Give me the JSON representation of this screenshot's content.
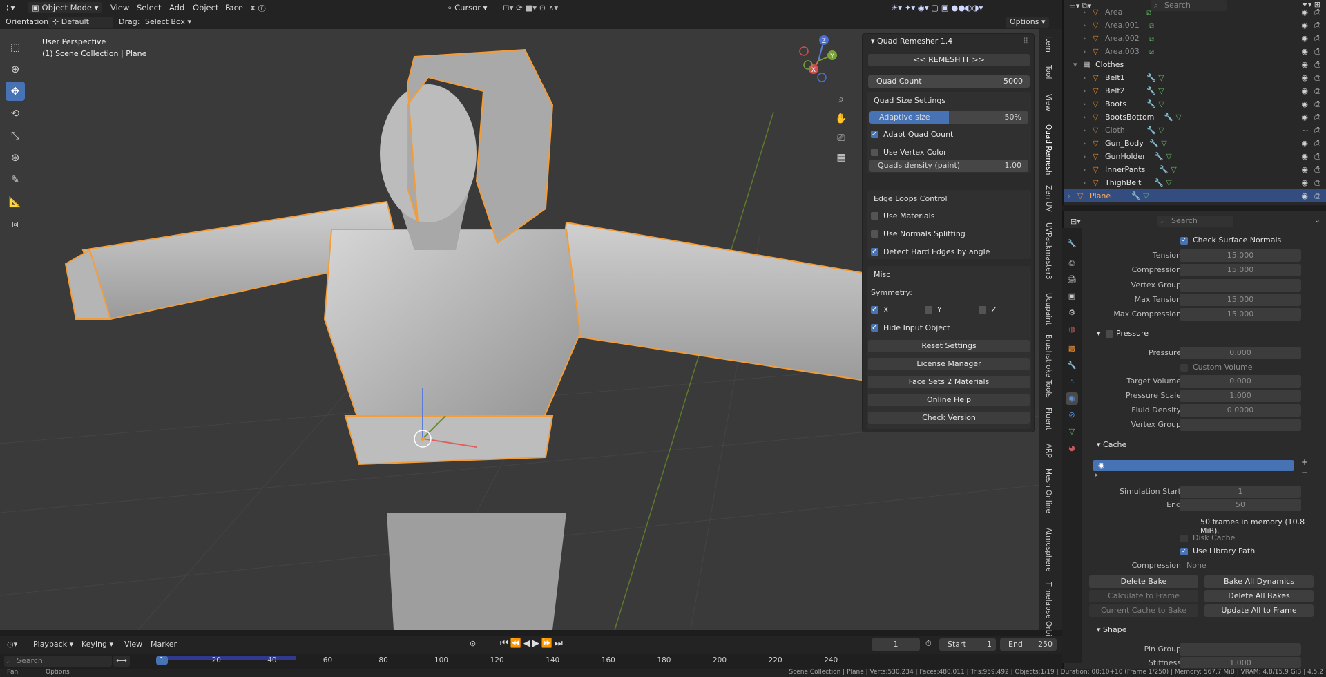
{
  "header": {
    "mode": "Object Mode",
    "menus": [
      "View",
      "Select",
      "Add",
      "Object",
      "Face"
    ],
    "pivot": "Cursor",
    "options": "Options"
  },
  "tool_header": {
    "orientation_label": "Orientation:",
    "orientation_value": "Default",
    "drag_label": "Drag:",
    "drag_value": "Select Box"
  },
  "viewport": {
    "perspective": "User Perspective",
    "collection": "(1) Scene Collection | Plane",
    "gizmo_axes": [
      "Z",
      "Y",
      "X"
    ]
  },
  "npanel": {
    "title": "Quad Remesher 1.4",
    "remesh_button": "<< REMESH IT >>",
    "quad_count_label": "Quad Count",
    "quad_count_value": "5000",
    "size_section": "Quad Size Settings",
    "adaptive_label": "Adaptive size",
    "adaptive_value": "50%",
    "adaptive_fraction": 0.5,
    "adapt_quad_count": "Adapt Quad Count",
    "use_vertex_color": "Use Vertex Color",
    "density_label": "Quads density (paint)",
    "density_value": "1.00",
    "edge_section": "Edge Loops Control",
    "use_materials": "Use Materials",
    "use_normals": "Use Normals Splitting",
    "detect_hard": "Detect Hard Edges by angle",
    "misc_section": "Misc",
    "symmetry_label": "Symmetry:",
    "sym_x": "X",
    "sym_y": "Y",
    "sym_z": "Z",
    "hide_input": "Hide Input Object",
    "buttons": [
      "Reset Settings",
      "License Manager",
      "Face Sets 2 Materials",
      "Online Help",
      "Check Version"
    ]
  },
  "vtabs": [
    "Item",
    "Tool",
    "View",
    "Quad Remesh",
    "Zen UV",
    "UVPackmaster3",
    "Ucupaint",
    "Brushstroke Tools",
    "Fluent",
    "ARP",
    "Mesh Online",
    "Atmosphere",
    "Timelapse Orbit"
  ],
  "timeline": {
    "menus": [
      "Playback",
      "Keying",
      "View",
      "Marker"
    ],
    "current_frame": "1",
    "start_label": "Start",
    "start_value": "1",
    "end_label": "End",
    "end_value": "250",
    "search_placeholder": "Search",
    "ticks": [
      "1",
      "20",
      "40",
      "60",
      "80",
      "100",
      "120",
      "140",
      "160",
      "180",
      "200",
      "220",
      "240"
    ]
  },
  "statusbar": {
    "left": [
      "Pan",
      "Options"
    ],
    "right": "Scene Collection | Plane | Verts:530,234 | Faces:480,011 | Tris:959,492 | Objects:1/19 | Duration: 00:10+10 (Frame 1/250) | Memory: 567.7 MiB | VRAM: 4.8/15.9 GiB | 4.5.2"
  },
  "outliner": {
    "search_placeholder": "Search",
    "rows": [
      {
        "name": "Area",
        "dim": true
      },
      {
        "name": "Area.001",
        "dim": true
      },
      {
        "name": "Area.002",
        "dim": true
      },
      {
        "name": "Area.003",
        "dim": true
      },
      {
        "name": "Clothes",
        "dim": false
      },
      {
        "name": "Belt1",
        "dim": false
      },
      {
        "name": "Belt2",
        "dim": false
      },
      {
        "name": "Boots",
        "dim": false
      },
      {
        "name": "BootsBottom",
        "dim": false
      },
      {
        "name": "Cloth",
        "dim": true
      },
      {
        "name": "Gun_Body",
        "dim": false
      },
      {
        "name": "GunHolder",
        "dim": false
      },
      {
        "name": "InnerPants",
        "dim": false
      },
      {
        "name": "ThighBelt",
        "dim": false
      },
      {
        "name": "Plane",
        "dim": false
      }
    ]
  },
  "properties": {
    "search_placeholder": "Search",
    "check_surface_normals": "Check Surface Normals",
    "tension_label": "Tension",
    "tension_value": "15.000",
    "compression_label": "Compression",
    "compression_value": "15.000",
    "vertex_group_label": "Vertex Group",
    "max_tension_label": "Max Tension",
    "max_tension_value": "15.000",
    "max_compression_label": "Max Compression",
    "max_compression_value": "15.000",
    "pressure_section": "Pressure",
    "pressure_label": "Pressure",
    "pressure_value": "0.000",
    "custom_volume": "Custom Volume",
    "target_volume_label": "Target Volume",
    "target_volume_value": "0.000",
    "pressure_scale_label": "Pressure Scale",
    "pressure_scale_value": "1.000",
    "fluid_density_label": "Fluid Density",
    "fluid_density_value": "0.0000",
    "vertex_group2_label": "Vertex Group",
    "cache_section": "Cache",
    "sim_start_label": "Simulation Start",
    "sim_start_value": "1",
    "end_label": "End",
    "end_value": "50",
    "frames_memory": "50 frames in memory (10.8 MiB).",
    "disk_cache": "Disk Cache",
    "use_library_path": "Use Library Path",
    "compression2_label": "Compression",
    "compression2_value": "None",
    "delete_bake": "Delete Bake",
    "bake_all": "Bake All Dynamics",
    "calc_to_frame": "Calculate to Frame",
    "delete_all_bakes": "Delete All Bakes",
    "current_cache": "Current Cache to Bake",
    "update_all": "Update All to Frame",
    "shape_section": "Shape",
    "pin_group_label": "Pin Group",
    "stiffness_label": "Stiffness",
    "stiffness_value": "1.000"
  },
  "colors": {
    "accent": "#4772b3",
    "selection": "#f29d3a",
    "bg": "#1d1d1d"
  }
}
